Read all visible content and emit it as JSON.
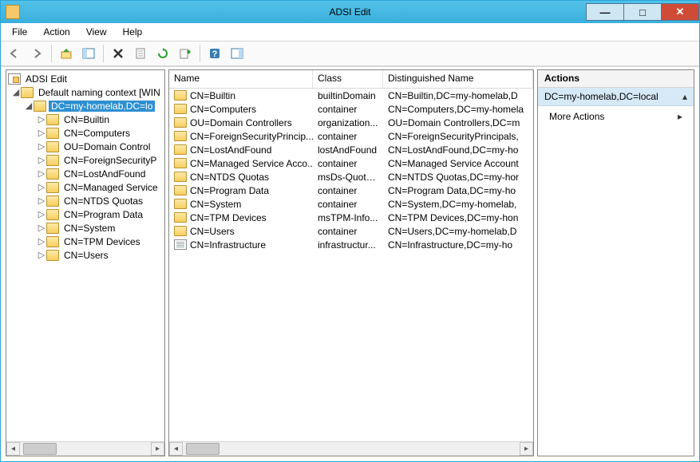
{
  "window": {
    "title": "ADSI Edit",
    "buttons": {
      "min": "—",
      "max": "□",
      "close": "✕"
    }
  },
  "menu": [
    "File",
    "Action",
    "View",
    "Help"
  ],
  "toolbar_icons": [
    "back",
    "forward",
    "up",
    "show-hide-tree",
    "delete",
    "copy",
    "refresh",
    "export-list",
    "properties",
    "help",
    "show-hide-action"
  ],
  "tree": {
    "root": "ADSI Edit",
    "context": "Default naming context [WIN",
    "selected": "DC=my-homelab,DC=lo",
    "children": [
      "CN=Builtin",
      "CN=Computers",
      "OU=Domain Control",
      "CN=ForeignSecurityP",
      "CN=LostAndFound",
      "CN=Managed Service",
      "CN=NTDS Quotas",
      "CN=Program Data",
      "CN=System",
      "CN=TPM Devices",
      "CN=Users"
    ]
  },
  "list": {
    "columns": {
      "name": "Name",
      "class": "Class",
      "dn": "Distinguished Name"
    },
    "rows": [
      {
        "icon": "folder",
        "name": "CN=Builtin",
        "class": "builtinDomain",
        "dn": "CN=Builtin,DC=my-homelab,D"
      },
      {
        "icon": "folder",
        "name": "CN=Computers",
        "class": "container",
        "dn": "CN=Computers,DC=my-homela"
      },
      {
        "icon": "folder",
        "name": "OU=Domain Controllers",
        "class": "organization...",
        "dn": "OU=Domain Controllers,DC=m"
      },
      {
        "icon": "folder",
        "name": "CN=ForeignSecurityPrincip...",
        "class": "container",
        "dn": "CN=ForeignSecurityPrincipals,"
      },
      {
        "icon": "folder",
        "name": "CN=LostAndFound",
        "class": "lostAndFound",
        "dn": "CN=LostAndFound,DC=my-ho"
      },
      {
        "icon": "folder",
        "name": "CN=Managed Service Acco...",
        "class": "container",
        "dn": "CN=Managed Service Account"
      },
      {
        "icon": "folder",
        "name": "CN=NTDS Quotas",
        "class": "msDs-Quota...",
        "dn": "CN=NTDS Quotas,DC=my-hor"
      },
      {
        "icon": "folder",
        "name": "CN=Program Data",
        "class": "container",
        "dn": "CN=Program Data,DC=my-ho"
      },
      {
        "icon": "folder",
        "name": "CN=System",
        "class": "container",
        "dn": "CN=System,DC=my-homelab,"
      },
      {
        "icon": "folder",
        "name": "CN=TPM Devices",
        "class": "msTPM-Info...",
        "dn": "CN=TPM Devices,DC=my-hon"
      },
      {
        "icon": "folder",
        "name": "CN=Users",
        "class": "container",
        "dn": "CN=Users,DC=my-homelab,D"
      },
      {
        "icon": "doc",
        "name": "CN=Infrastructure",
        "class": "infrastructur...",
        "dn": "CN=Infrastructure,DC=my-ho"
      }
    ]
  },
  "actions": {
    "header": "Actions",
    "selected": "DC=my-homelab,DC=local",
    "more": "More Actions"
  }
}
